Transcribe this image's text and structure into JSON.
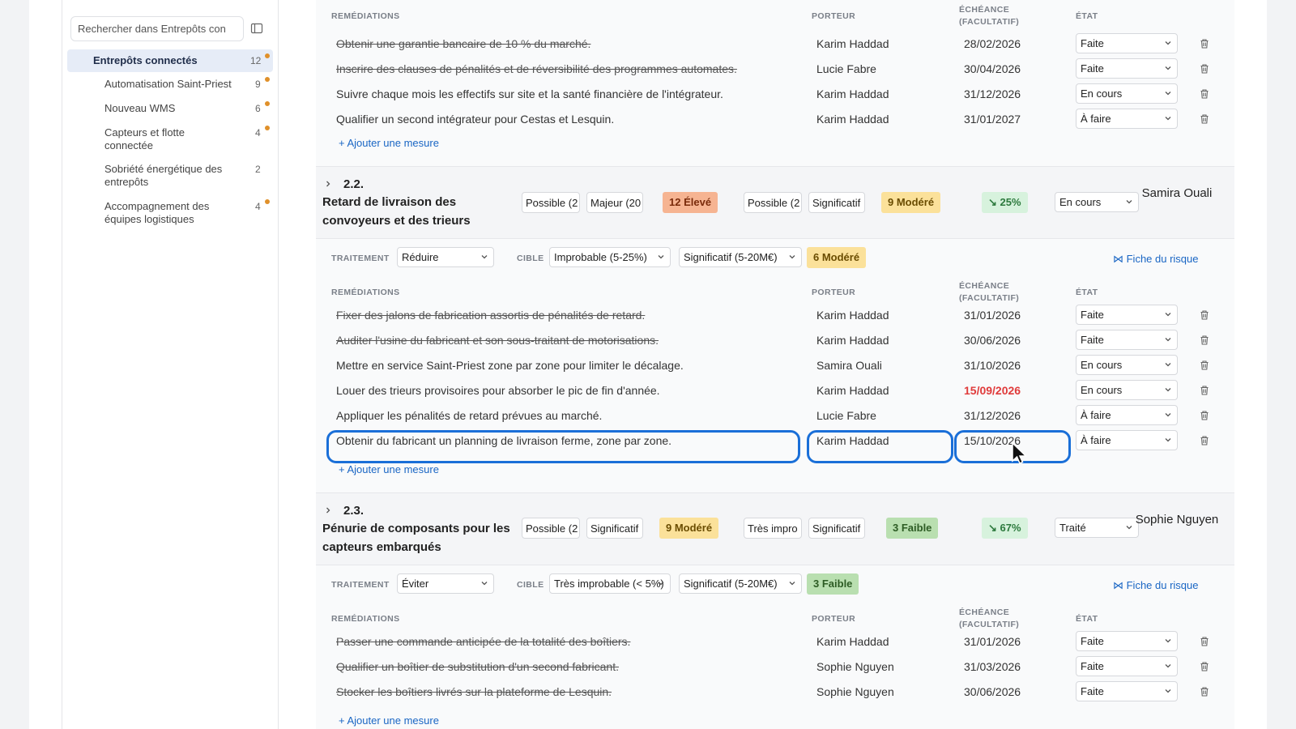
{
  "sidebar": {
    "search_placeholder": "Rechercher dans Entrepôts con",
    "parent": {
      "label": "Entrepôts connectés",
      "count": "12"
    },
    "items": [
      {
        "label": "Automatisation Saint-Priest",
        "count": "9",
        "dot": true
      },
      {
        "label": "Nouveau WMS",
        "count": "6",
        "dot": true
      },
      {
        "label": "Capteurs et flotte connectée",
        "count": "4",
        "dot": true
      },
      {
        "label": "Sobriété énergétique des entrepôts",
        "count": "2",
        "dot": false
      },
      {
        "label": "Accompagnement des équipes logistiques",
        "count": "4",
        "dot": true
      }
    ]
  },
  "columns": {
    "remediations": "REMÉDIATIONS",
    "owner": "PORTEUR",
    "due": "ÉCHÉANCE (FACULTATIF)",
    "state": "ÉTAT",
    "treatment": "TRAITEMENT",
    "target": "CIBLE"
  },
  "add_label": "+ Ajouter une mesure",
  "fiche_label": "⋈ Fiche du risque",
  "top_rows": [
    {
      "text": "Obtenir une garantie bancaire de 10 % du marché.",
      "done": true,
      "owner": "Karim Haddad",
      "due": "28/02/2026",
      "state": "Faite"
    },
    {
      "text": "Inscrire des clauses de pénalités et de réversibilité des programmes automates.",
      "done": true,
      "owner": "Lucie Fabre",
      "due": "30/04/2026",
      "state": "Faite"
    },
    {
      "text": "Suivre chaque mois les effectifs sur site et la santé financière de l'intégrateur.",
      "done": false,
      "owner": "Karim Haddad",
      "due": "31/12/2026",
      "state": "En cours"
    },
    {
      "text": "Qualifier un second intégrateur pour Cestas et Lesquin.",
      "done": false,
      "owner": "Karim Haddad",
      "due": "31/01/2027",
      "state": "À faire"
    }
  ],
  "risk22": {
    "num": "2.2.",
    "title": "Retard de livraison des convoyeurs et des trieurs",
    "prob": "Possible (2",
    "impact": "Majeur (20",
    "score": "12  Élevé",
    "res_prob": "Possible (2",
    "res_impact": "Significatif",
    "res_score": "9  Modéré",
    "trend": "↘ 25%",
    "status": "En cours",
    "person": "Samira Ouali",
    "treatment": "Réduire",
    "target_prob": "Improbable (5-25%)",
    "target_impact": "Significatif (5-20M€)",
    "target_score": "6  Modéré",
    "rows": [
      {
        "text": "Fixer des jalons de fabrication assortis de pénalités de retard.",
        "done": true,
        "owner": "Karim Haddad",
        "due": "31/01/2026",
        "state": "Faite",
        "late": false
      },
      {
        "text": "Auditer l'usine du fabricant et son sous-traitant de motorisations.",
        "done": true,
        "owner": "Karim Haddad",
        "due": "30/06/2026",
        "state": "Faite",
        "late": false
      },
      {
        "text": "Mettre en service Saint-Priest zone par zone pour limiter le décalage.",
        "done": false,
        "owner": "Samira Ouali",
        "due": "31/10/2026",
        "state": "En cours",
        "late": false
      },
      {
        "text": "Louer des trieurs provisoires pour absorber le pic de fin d'année.",
        "done": false,
        "owner": "Karim Haddad",
        "due": "15/09/2026",
        "state": "En cours",
        "late": true
      },
      {
        "text": "Appliquer les pénalités de retard prévues au marché.",
        "done": false,
        "owner": "Lucie Fabre",
        "due": "31/12/2026",
        "state": "À faire",
        "late": false
      },
      {
        "text": "Obtenir du fabricant un planning de livraison ferme, zone par zone.",
        "done": false,
        "owner": "Karim Haddad",
        "due": "15/10/2026",
        "state": "À faire",
        "late": false
      }
    ]
  },
  "risk23": {
    "num": "2.3.",
    "title": "Pénurie de composants pour les capteurs embarqués",
    "prob": "Possible (2",
    "impact": "Significatif",
    "score": "9  Modéré",
    "res_prob": "Très impro",
    "res_impact": "Significatif",
    "res_score": "3  Faible",
    "trend": "↘ 67%",
    "status": "Traité",
    "person": "Sophie Nguyen",
    "treatment": "Éviter",
    "target_prob": "Très improbable (< 5%)",
    "target_impact": "Significatif (5-20M€)",
    "target_score": "3  Faible",
    "rows": [
      {
        "text": "Passer une commande anticipée de la totalité des boîtiers.",
        "done": true,
        "owner": "Karim Haddad",
        "due": "31/01/2026",
        "state": "Faite"
      },
      {
        "text": "Qualifier un boîtier de substitution d'un second fabricant.",
        "done": true,
        "owner": "Sophie Nguyen",
        "due": "31/03/2026",
        "state": "Faite"
      },
      {
        "text": "Stocker les boîtiers livrés sur la plateforme de Lesquin.",
        "done": true,
        "owner": "Sophie Nguyen",
        "due": "30/06/2026",
        "state": "Faite"
      }
    ]
  }
}
